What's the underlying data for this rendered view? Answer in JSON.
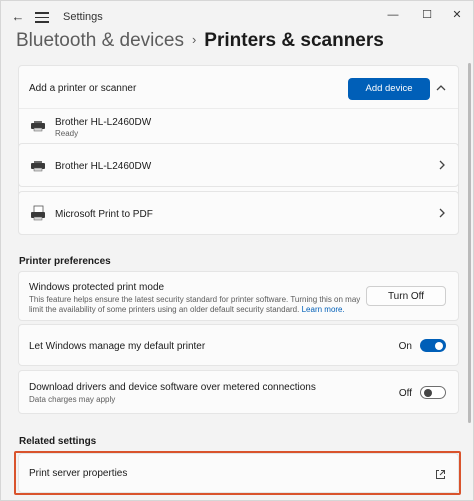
{
  "window": {
    "app_title": "Settings",
    "controls": {
      "minimize": "—",
      "maximize": "☐",
      "close": "✕"
    }
  },
  "breadcrumb": {
    "parent": "Bluetooth & devices",
    "separator": "›",
    "current": "Printers & scanners"
  },
  "add_section": {
    "label": "Add a printer or scanner",
    "button": "Add device"
  },
  "printers": [
    {
      "name": "Brother HL-L2460DW",
      "status": "Ready"
    },
    {
      "name": "Brother HL-L2460DW",
      "status": ""
    },
    {
      "name": "Microsoft Print to PDF",
      "status": ""
    }
  ],
  "printer_preferences": {
    "heading": "Printer preferences",
    "protected_mode": {
      "title": "Windows protected print mode",
      "description_line1": "This feature helps ensure the latest security standard for printer software. Turning this on may",
      "description_line2": "limit the availability of some printers using an older default security standard.",
      "learn_more": "Learn more.",
      "button": "Turn Off"
    },
    "default_printer": {
      "title": "Let Windows manage my default printer",
      "state_label": "On",
      "on": true
    },
    "metered": {
      "title": "Download drivers and device software over metered connections",
      "subtitle": "Data charges may apply",
      "state_label": "Off",
      "on": false
    }
  },
  "related_settings": {
    "heading": "Related settings",
    "print_server": "Print server properties"
  },
  "colors": {
    "accent": "#005fb8",
    "highlight": "#d9532c"
  },
  "icons": [
    "back-arrow-icon",
    "menu-icon",
    "printer-icon",
    "pdf-printer-icon",
    "chevron-up-icon",
    "chevron-right-icon",
    "external-link-icon"
  ]
}
